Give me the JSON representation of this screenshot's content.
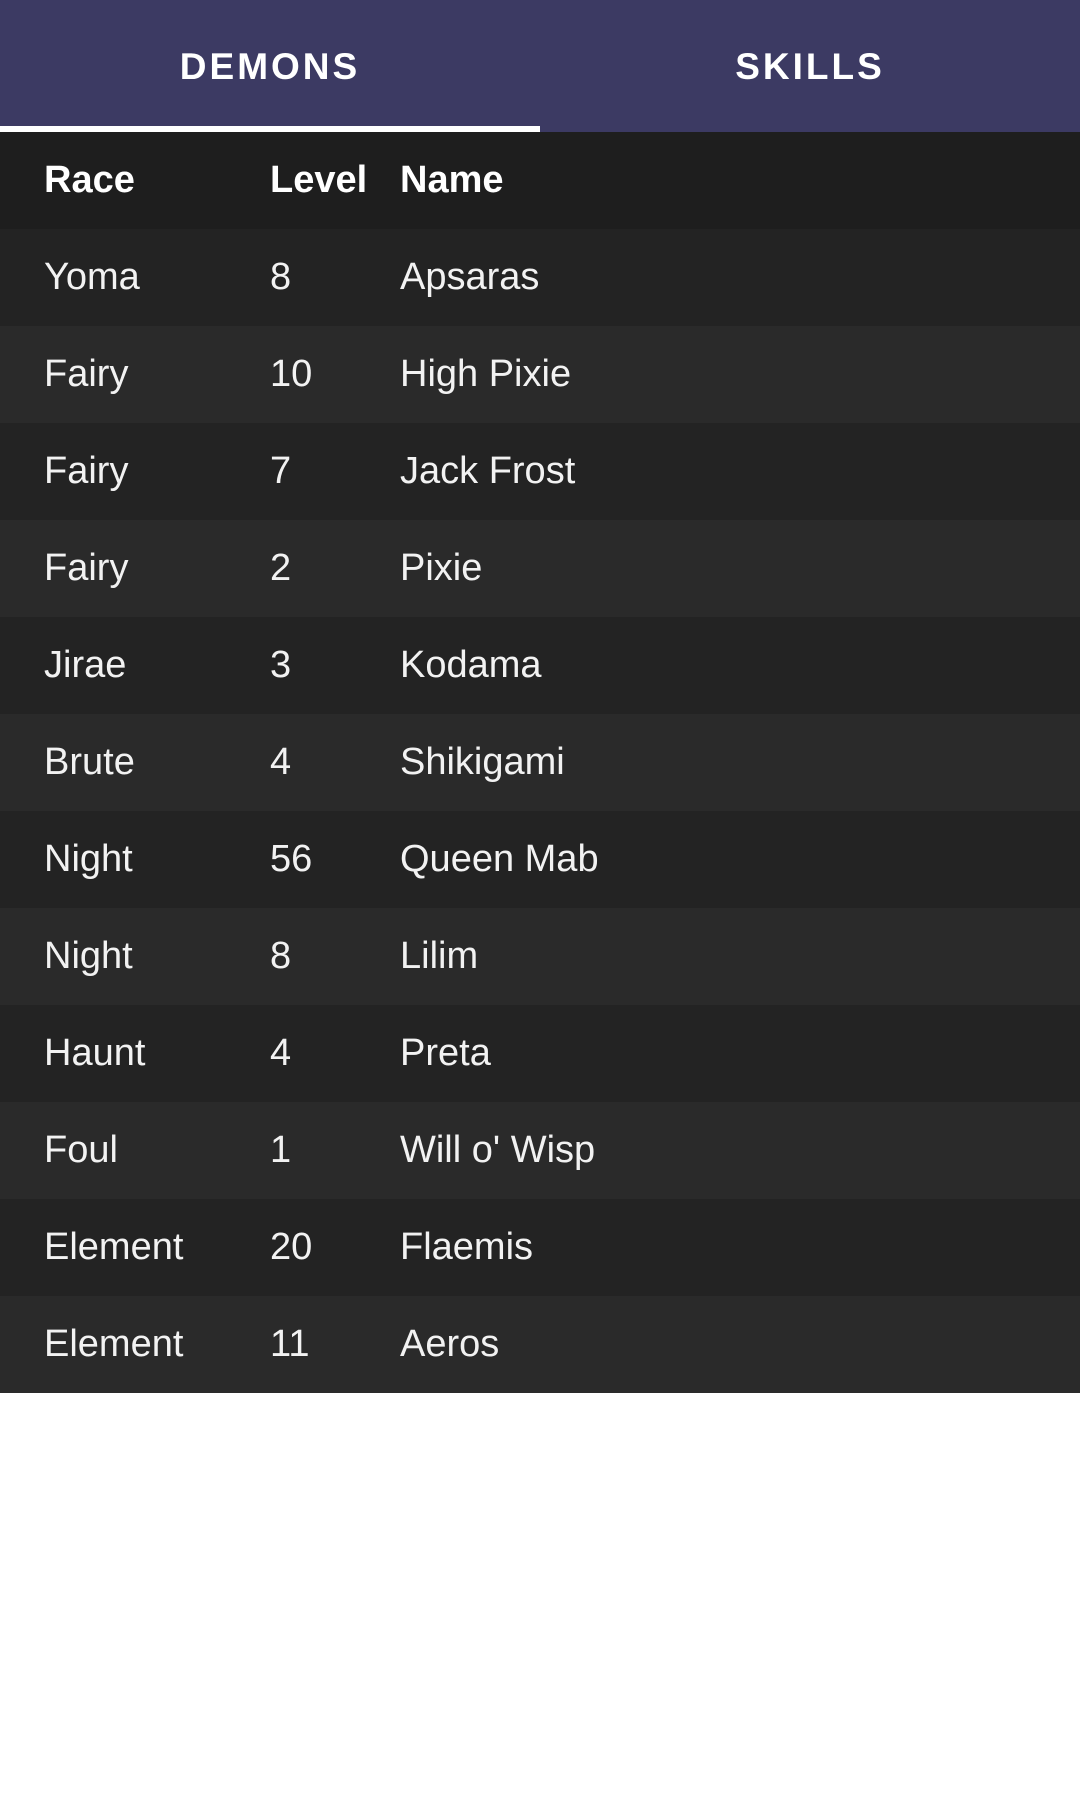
{
  "tabs": [
    {
      "label": "DEMONS",
      "active": true
    },
    {
      "label": "SKILLS",
      "active": false
    }
  ],
  "colors": {
    "tabbar": "#3c3a63",
    "header": "#1e1e1e",
    "row_dark": "#232323",
    "row_light": "#2a2a2a",
    "text": "#ffffff"
  },
  "table": {
    "headers": {
      "race": "Race",
      "level": "Level",
      "name": "Name"
    },
    "rows": [
      {
        "race": "Yoma",
        "level": "8",
        "name": "Apsaras"
      },
      {
        "race": "Fairy",
        "level": "10",
        "name": "High Pixie"
      },
      {
        "race": "Fairy",
        "level": "7",
        "name": "Jack Frost"
      },
      {
        "race": "Fairy",
        "level": "2",
        "name": "Pixie"
      },
      {
        "race": "Jirae",
        "level": "3",
        "name": "Kodama"
      },
      {
        "race": "Brute",
        "level": "4",
        "name": "Shikigami"
      },
      {
        "race": "Night",
        "level": "56",
        "name": "Queen Mab"
      },
      {
        "race": "Night",
        "level": "8",
        "name": "Lilim"
      },
      {
        "race": "Haunt",
        "level": "4",
        "name": "Preta"
      },
      {
        "race": "Foul",
        "level": "1",
        "name": "Will o' Wisp"
      },
      {
        "race": "Element",
        "level": "20",
        "name": "Flaemis"
      },
      {
        "race": "Element",
        "level": "11",
        "name": "Aeros"
      }
    ]
  }
}
